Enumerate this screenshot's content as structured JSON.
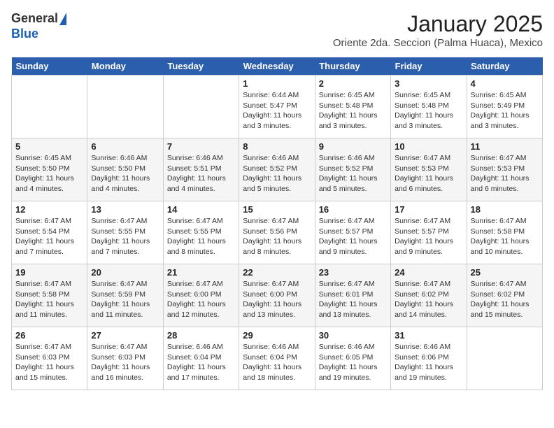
{
  "header": {
    "logo_general": "General",
    "logo_blue": "Blue",
    "month_title": "January 2025",
    "location": "Oriente 2da. Seccion (Palma Huaca), Mexico"
  },
  "weekdays": [
    "Sunday",
    "Monday",
    "Tuesday",
    "Wednesday",
    "Thursday",
    "Friday",
    "Saturday"
  ],
  "weeks": [
    [
      {
        "day": "",
        "info": ""
      },
      {
        "day": "",
        "info": ""
      },
      {
        "day": "",
        "info": ""
      },
      {
        "day": "1",
        "info": "Sunrise: 6:44 AM\nSunset: 5:47 PM\nDaylight: 11 hours and 3 minutes."
      },
      {
        "day": "2",
        "info": "Sunrise: 6:45 AM\nSunset: 5:48 PM\nDaylight: 11 hours and 3 minutes."
      },
      {
        "day": "3",
        "info": "Sunrise: 6:45 AM\nSunset: 5:48 PM\nDaylight: 11 hours and 3 minutes."
      },
      {
        "day": "4",
        "info": "Sunrise: 6:45 AM\nSunset: 5:49 PM\nDaylight: 11 hours and 3 minutes."
      }
    ],
    [
      {
        "day": "5",
        "info": "Sunrise: 6:45 AM\nSunset: 5:50 PM\nDaylight: 11 hours and 4 minutes."
      },
      {
        "day": "6",
        "info": "Sunrise: 6:46 AM\nSunset: 5:50 PM\nDaylight: 11 hours and 4 minutes."
      },
      {
        "day": "7",
        "info": "Sunrise: 6:46 AM\nSunset: 5:51 PM\nDaylight: 11 hours and 4 minutes."
      },
      {
        "day": "8",
        "info": "Sunrise: 6:46 AM\nSunset: 5:52 PM\nDaylight: 11 hours and 5 minutes."
      },
      {
        "day": "9",
        "info": "Sunrise: 6:46 AM\nSunset: 5:52 PM\nDaylight: 11 hours and 5 minutes."
      },
      {
        "day": "10",
        "info": "Sunrise: 6:47 AM\nSunset: 5:53 PM\nDaylight: 11 hours and 6 minutes."
      },
      {
        "day": "11",
        "info": "Sunrise: 6:47 AM\nSunset: 5:53 PM\nDaylight: 11 hours and 6 minutes."
      }
    ],
    [
      {
        "day": "12",
        "info": "Sunrise: 6:47 AM\nSunset: 5:54 PM\nDaylight: 11 hours and 7 minutes."
      },
      {
        "day": "13",
        "info": "Sunrise: 6:47 AM\nSunset: 5:55 PM\nDaylight: 11 hours and 7 minutes."
      },
      {
        "day": "14",
        "info": "Sunrise: 6:47 AM\nSunset: 5:55 PM\nDaylight: 11 hours and 8 minutes."
      },
      {
        "day": "15",
        "info": "Sunrise: 6:47 AM\nSunset: 5:56 PM\nDaylight: 11 hours and 8 minutes."
      },
      {
        "day": "16",
        "info": "Sunrise: 6:47 AM\nSunset: 5:57 PM\nDaylight: 11 hours and 9 minutes."
      },
      {
        "day": "17",
        "info": "Sunrise: 6:47 AM\nSunset: 5:57 PM\nDaylight: 11 hours and 9 minutes."
      },
      {
        "day": "18",
        "info": "Sunrise: 6:47 AM\nSunset: 5:58 PM\nDaylight: 11 hours and 10 minutes."
      }
    ],
    [
      {
        "day": "19",
        "info": "Sunrise: 6:47 AM\nSunset: 5:58 PM\nDaylight: 11 hours and 11 minutes."
      },
      {
        "day": "20",
        "info": "Sunrise: 6:47 AM\nSunset: 5:59 PM\nDaylight: 11 hours and 11 minutes."
      },
      {
        "day": "21",
        "info": "Sunrise: 6:47 AM\nSunset: 6:00 PM\nDaylight: 11 hours and 12 minutes."
      },
      {
        "day": "22",
        "info": "Sunrise: 6:47 AM\nSunset: 6:00 PM\nDaylight: 11 hours and 13 minutes."
      },
      {
        "day": "23",
        "info": "Sunrise: 6:47 AM\nSunset: 6:01 PM\nDaylight: 11 hours and 13 minutes."
      },
      {
        "day": "24",
        "info": "Sunrise: 6:47 AM\nSunset: 6:02 PM\nDaylight: 11 hours and 14 minutes."
      },
      {
        "day": "25",
        "info": "Sunrise: 6:47 AM\nSunset: 6:02 PM\nDaylight: 11 hours and 15 minutes."
      }
    ],
    [
      {
        "day": "26",
        "info": "Sunrise: 6:47 AM\nSunset: 6:03 PM\nDaylight: 11 hours and 15 minutes."
      },
      {
        "day": "27",
        "info": "Sunrise: 6:47 AM\nSunset: 6:03 PM\nDaylight: 11 hours and 16 minutes."
      },
      {
        "day": "28",
        "info": "Sunrise: 6:46 AM\nSunset: 6:04 PM\nDaylight: 11 hours and 17 minutes."
      },
      {
        "day": "29",
        "info": "Sunrise: 6:46 AM\nSunset: 6:04 PM\nDaylight: 11 hours and 18 minutes."
      },
      {
        "day": "30",
        "info": "Sunrise: 6:46 AM\nSunset: 6:05 PM\nDaylight: 11 hours and 19 minutes."
      },
      {
        "day": "31",
        "info": "Sunrise: 6:46 AM\nSunset: 6:06 PM\nDaylight: 11 hours and 19 minutes."
      },
      {
        "day": "",
        "info": ""
      }
    ]
  ]
}
